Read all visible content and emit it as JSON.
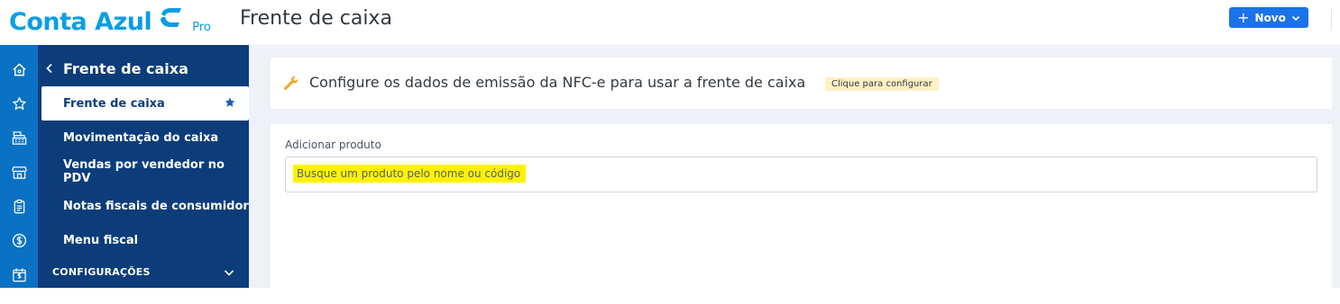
{
  "header": {
    "logo_text": "Conta Azul",
    "logo_suffix": "Pro",
    "page_title": "Frente de caixa",
    "new_button_label": "Novo"
  },
  "icon_rail": {
    "items": [
      "home-icon",
      "star-icon",
      "cash-register-icon",
      "store-icon",
      "clipboard-icon",
      "dollar-icon",
      "calendar-dollar-icon"
    ]
  },
  "sidebar": {
    "back_title": "Frente de caixa",
    "items": [
      {
        "label": "Frente de caixa",
        "active": true,
        "favorite": true
      },
      {
        "label": "Movimentação do caixa"
      },
      {
        "label": "Vendas por vendedor no PDV"
      },
      {
        "label": "Notas fiscais de consumidor"
      },
      {
        "label": "Menu fiscal"
      }
    ],
    "config_section": "CONFIGURAÇÕES"
  },
  "notice": {
    "message": "Configure os dados de emissão da NFC-e para usar a frente de caixa",
    "badge": "Clique para configurar"
  },
  "product": {
    "label": "Adicionar produto",
    "placeholder": "Busque um produto pelo nome ou código"
  },
  "colors": {
    "brand": "#0b9de6",
    "sidebar_bg": "#0c3d7a",
    "icon_rail_bg": "#0a72c4",
    "primary_button": "#1a73e8",
    "badge_bg": "#fff1c4",
    "highlight": "#fff200"
  }
}
